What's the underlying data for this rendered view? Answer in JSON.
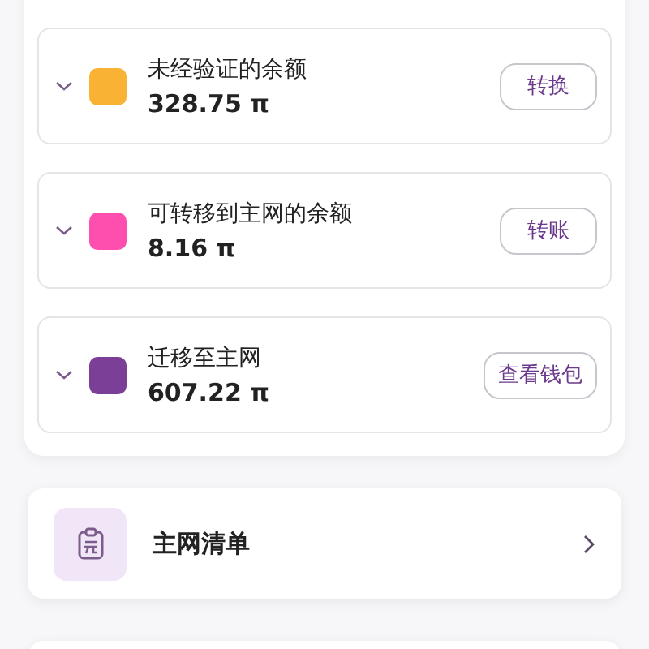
{
  "balances": [
    {
      "label": "未经验证的余额",
      "amount": "328.75 π",
      "color": "#f9b233",
      "action": "转换",
      "expanded": false
    },
    {
      "label": "可转移到主网的余额",
      "amount": "8.16 π",
      "color": "#ff4fae",
      "action": "转账",
      "expanded": false
    },
    {
      "label": "迁移至主网",
      "amount": "607.22 π",
      "color": "#7b3f98",
      "action": "查看钱包",
      "expanded": false
    }
  ],
  "menu": [
    {
      "label": "主网清单"
    }
  ]
}
